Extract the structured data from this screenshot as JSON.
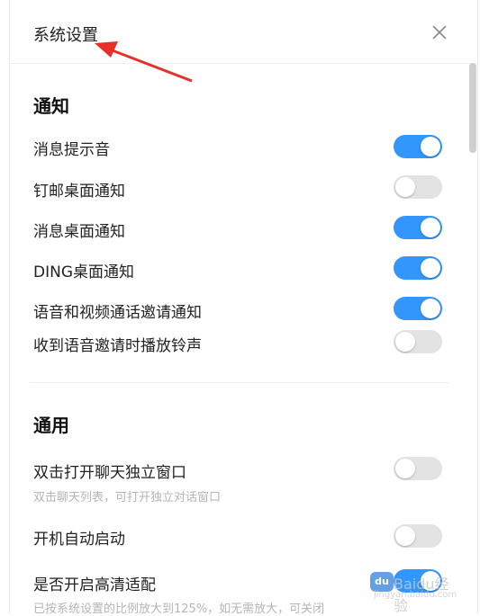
{
  "dialog": {
    "title": "系统设置",
    "close_icon": "close-icon"
  },
  "sections": {
    "notify": {
      "title": "通知",
      "items": [
        {
          "label": "消息提示音",
          "on": true
        },
        {
          "label": "钉邮桌面通知",
          "on": false
        },
        {
          "label": "消息桌面通知",
          "on": true
        },
        {
          "label": "DING桌面通知",
          "on": true
        },
        {
          "label": "语音和视频通话邀请通知",
          "on": true
        },
        {
          "label": "收到语音邀请时播放铃声",
          "on": false
        }
      ]
    },
    "general": {
      "title": "通用",
      "items": [
        {
          "label": "双击打开聊天独立窗口",
          "sublabel": "双击聊天列表，可打开独立对话窗口",
          "on": false
        },
        {
          "label": "开机自动启动",
          "on": false
        },
        {
          "label": "是否开启高清适配",
          "sublabel": "已按系统设置的比例放大到125%，如无需放大，可关闭",
          "on": true
        }
      ]
    }
  },
  "watermark": {
    "logo": "Baidu经验",
    "domain": "jingyan.baidu.com"
  },
  "colors": {
    "toggle_on": "#3296fa",
    "toggle_off": "#e3e3e3",
    "arrow": "#e8302a"
  }
}
